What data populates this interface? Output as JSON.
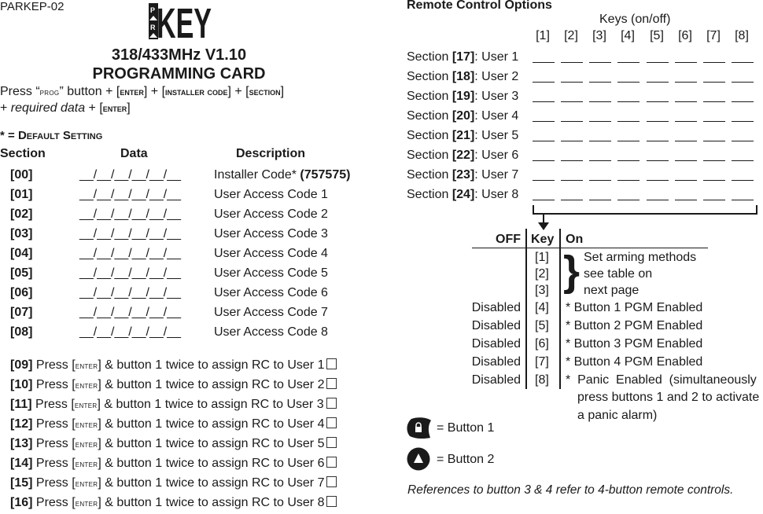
{
  "header": {
    "doc_id": "PARKEP-02",
    "logo_text": "KEY",
    "logo_side_letters": [
      "P",
      "R"
    ],
    "title_line1": "318/433MHz V1.10",
    "title_line2": "PROGRAMMING CARD"
  },
  "instructions": {
    "line1_parts": [
      "Press “",
      "prog",
      "” button + [",
      "enter",
      "] + [",
      "installer code",
      "] + [",
      "section",
      "]"
    ],
    "line2_parts": [
      "+ ",
      "required data",
      " + [",
      "enter",
      "]"
    ],
    "default_note_star": "*",
    "default_note_eq": " = ",
    "default_note_label": "Default Setting"
  },
  "code_table": {
    "headers": {
      "section": "Section",
      "data": "Data",
      "description": "Description"
    },
    "data_placeholder": "__/__/__/__/__/__",
    "rows": [
      {
        "section": "[00]",
        "description": "Installer Code*",
        "default": "(757575)"
      },
      {
        "section": "[01]",
        "description": "User Access Code 1"
      },
      {
        "section": "[02]",
        "description": "User Access Code 2"
      },
      {
        "section": "[03]",
        "description": "User Access Code 3"
      },
      {
        "section": "[04]",
        "description": "User Access Code 4"
      },
      {
        "section": "[05]",
        "description": "User Access Code 5"
      },
      {
        "section": "[06]",
        "description": "User Access Code 6"
      },
      {
        "section": "[07]",
        "description": "User Access Code 7"
      },
      {
        "section": "[08]",
        "description": "User Access Code 8"
      }
    ]
  },
  "rc_assign": {
    "press": "Press [",
    "enter": "enter",
    "rest": "] & button 1 twice to assign RC to User ",
    "rows": [
      {
        "section": "[09]",
        "user": "1"
      },
      {
        "section": "[10]",
        "user": "2"
      },
      {
        "section": "[11]",
        "user": "3"
      },
      {
        "section": "[12]",
        "user": "4"
      },
      {
        "section": "[13]",
        "user": "5"
      },
      {
        "section": "[14]",
        "user": "6"
      },
      {
        "section": "[15]",
        "user": "7"
      },
      {
        "section": "[16]",
        "user": "8"
      }
    ]
  },
  "remote_options": {
    "title": "Remote Control Options",
    "keys_title": "Keys (on/off)",
    "key_headers": [
      "[1]",
      "[2]",
      "[3]",
      "[4]",
      "[5]",
      "[6]",
      "[7]",
      "[8]"
    ],
    "section_word": "Section ",
    "rows": [
      {
        "section": "[17]",
        "user": "User 1"
      },
      {
        "section": "[18]",
        "user": "User 2"
      },
      {
        "section": "[19]",
        "user": "User 3"
      },
      {
        "section": "[20]",
        "user": "User 4"
      },
      {
        "section": "[21]",
        "user": "User 5"
      },
      {
        "section": "[22]",
        "user": "User 6"
      },
      {
        "section": "[23]",
        "user": "User 7"
      },
      {
        "section": "[24]",
        "user": "User 8"
      }
    ]
  },
  "key_legend": {
    "headers": {
      "off": "OFF",
      "key": "Key",
      "on": "On"
    },
    "arming_keys": [
      "[1]",
      "[2]",
      "[3]"
    ],
    "arming_text": [
      "Set arming methods",
      "see table on",
      "next page"
    ],
    "rows": [
      {
        "off": "Disabled",
        "key": "[4]",
        "on": "* Button 1 PGM Enabled"
      },
      {
        "off": "Disabled",
        "key": "[5]",
        "on": "* Button 2 PGM Enabled"
      },
      {
        "off": "Disabled",
        "key": "[6]",
        "on": "* Button 3 PGM Enabled"
      },
      {
        "off": "Disabled",
        "key": "[7]",
        "on": "* Button 4 PGM Enabled"
      },
      {
        "off": "Disabled",
        "key": "[8]",
        "on": "*  Panic  Enabled  (simultaneously"
      }
    ],
    "panic_cont": [
      "press buttons 1 and 2 to activate",
      "a panic alarm)"
    ]
  },
  "buttons": [
    {
      "icon": "lock-button-icon",
      "label": "= Button 1"
    },
    {
      "icon": "triangle-button-icon",
      "label": "= Button 2"
    }
  ],
  "footnote": "References to button 3 & 4 refer to 4-button remote controls."
}
